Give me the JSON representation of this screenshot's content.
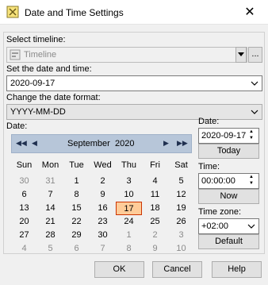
{
  "window": {
    "title": "Date and Time Settings",
    "close_glyph": "✕"
  },
  "timeline": {
    "label": "Select timeline:",
    "value": "Timeline",
    "more_button": "..."
  },
  "date_time": {
    "label": "Set the date and time:",
    "value": "2020-09-17"
  },
  "format": {
    "label": "Change the date format:",
    "value": "YYYY-MM-DD"
  },
  "calendar": {
    "label": "Date:",
    "month": "September",
    "year": "2020",
    "nav_prev_year": "◀◀",
    "nav_prev_month": "◀",
    "nav_next_month": "▶",
    "nav_next_year": "▶▶",
    "weekdays": [
      "Sun",
      "Mon",
      "Tue",
      "Wed",
      "Thu",
      "Fri",
      "Sat"
    ],
    "weeks": [
      [
        "30",
        "31",
        "1",
        "2",
        "3",
        "4",
        "5"
      ],
      [
        "6",
        "7",
        "8",
        "9",
        "10",
        "11",
        "12"
      ],
      [
        "13",
        "14",
        "15",
        "16",
        "17",
        "18",
        "19"
      ],
      [
        "20",
        "21",
        "22",
        "23",
        "24",
        "25",
        "26"
      ],
      [
        "27",
        "28",
        "29",
        "30",
        "1",
        "2",
        "3"
      ],
      [
        "4",
        "5",
        "6",
        "7",
        "8",
        "9",
        "10"
      ]
    ],
    "selected": "17"
  },
  "side": {
    "date_label": "Date:",
    "date_value": "2020-09-17",
    "today_button": "Today",
    "time_label": "Time:",
    "time_value": "00:00:00",
    "now_button": "Now",
    "tz_label": "Time zone:",
    "tz_value": "+02:00",
    "default_button": "Default"
  },
  "footer": {
    "ok": "OK",
    "cancel": "Cancel",
    "help": "Help"
  },
  "colors": {
    "today_fill": "#ffcc99",
    "today_border": "#cc3300",
    "cal_header": "#b7c6d9"
  }
}
